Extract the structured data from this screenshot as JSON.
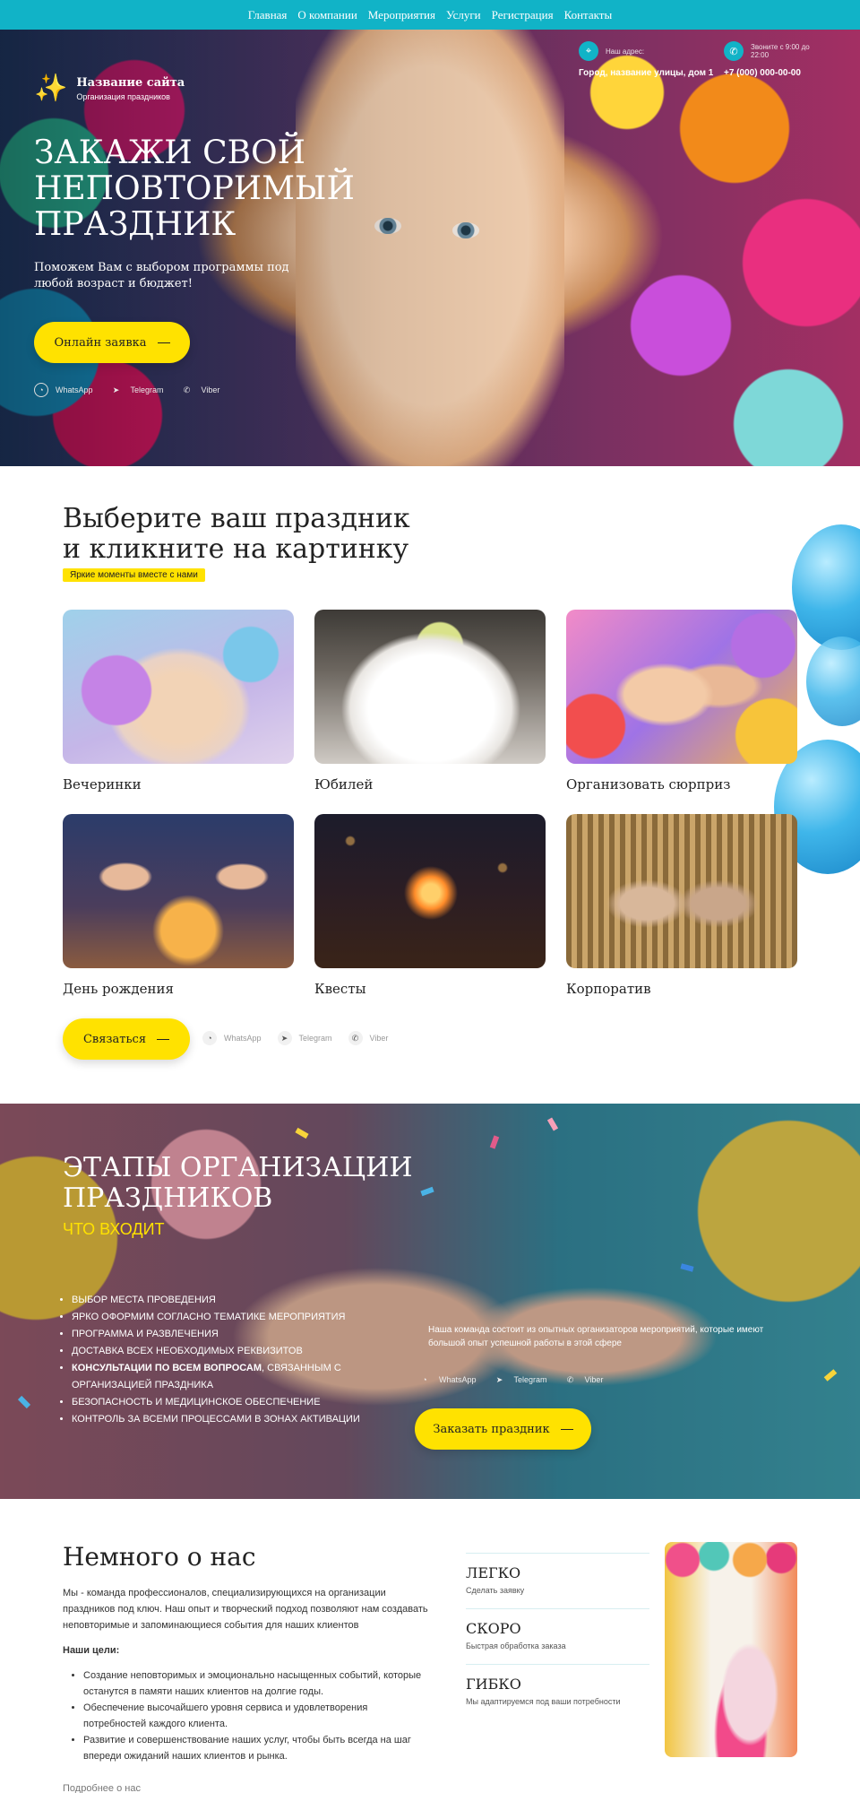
{
  "nav": [
    "Главная",
    "О компании",
    "Мероприятия",
    "Услуги",
    "Регистрация",
    "Контакты"
  ],
  "brand": {
    "title": "Название сайта",
    "subtitle": "Организация праздников"
  },
  "contacts": {
    "address_label": "Наш адрес:",
    "address_value": "Город, название улицы, дом 1",
    "phone_label": "Звоните с 9:00 до 22:00",
    "phone_value": "+7 (000) 000-00-00"
  },
  "hero": {
    "title": "ЗАКАЖИ СВОЙ НЕПОВТОРИМЫЙ ПРАЗДНИК",
    "subtitle": "Поможем Вам с выбором программы под любой возраст и бюджет!",
    "cta": "Онлайн заявка"
  },
  "social": {
    "whatsapp": "WhatsApp",
    "telegram": "Telegram",
    "viber": "Viber"
  },
  "choose": {
    "title_line1": "Выберите ваш праздник",
    "title_line2": "и кликните на картинку",
    "tag": "Яркие моменты вместе с нами",
    "cards": [
      "Вечеринки",
      "Юбилей",
      "Организовать сюрприз",
      "День рождения",
      "Квесты",
      "Корпоратив"
    ],
    "cta": "Связаться"
  },
  "stages": {
    "title": "ЭТАПЫ ОРГАНИЗАЦИИ ПРАЗДНИКОВ",
    "includes": "ЧТО ВХОДИТ",
    "items": [
      "ВЫБОР МЕСТА ПРОВЕДЕНИЯ",
      "ЯРКО ОФОРМИМ СОГЛАСНО ТЕМАТИКЕ МЕРОПРИЯТИЯ",
      "ПРОГРАММА И РАЗВЛЕЧЕНИЯ",
      "ДОСТАВКА ВСЕХ НЕОБХОДИМЫХ РЕКВИЗИТОВ"
    ],
    "item_bold": "КОНСУЛЬТАЦИИ ПО ВСЕМ ВОПРОСАМ",
    "item_bold_rest": ", СВЯЗАННЫМ С ОРГАНИЗАЦИЕЙ ПРАЗДНИКА",
    "items_after": [
      "БЕЗОПАСНОСТЬ И МЕДИЦИНСКОЕ ОБЕСПЕЧЕНИЕ",
      "КОНТРОЛЬ ЗА ВСЕМИ ПРОЦЕССАМИ В ЗОНАХ АКТИВАЦИИ"
    ],
    "team": "Наша команда состоит из опытных организаторов мероприятий, которые имеют большой опыт успешной работы в этой сфере",
    "cta": "Заказать праздник"
  },
  "about": {
    "title": "Немного о нас",
    "text": "Мы - команда профессионалов, специализирующихся на организации праздников под ключ. Наш опыт и творческий подход позволяют нам создавать неповторимые и запоминающиеся события для наших клиентов",
    "goals_title": "Наши цели:",
    "goals": [
      "Создание неповторимых и эмоционально насыщенных событий, которые останутся в памяти наших клиентов на долгие годы.",
      "Обеспечение высочайшего уровня сервиса и удовлетворения потребностей каждого клиента.",
      "Развитие и совершенствование наших услуг, чтобы быть всегда на шаг впереди ожиданий наших клиентов и рынка."
    ],
    "more": "Подробнее о нас",
    "features": [
      {
        "title": "ЛЕГКО",
        "desc": "Сделать заявку"
      },
      {
        "title": "СКОРО",
        "desc": "Быстрая обработка заказа"
      },
      {
        "title": "ГИБКО",
        "desc": "Мы адаптируемся под ваши потребности"
      }
    ]
  },
  "colors": {
    "accent": "#11b3c7",
    "yellow": "#ffe200"
  }
}
